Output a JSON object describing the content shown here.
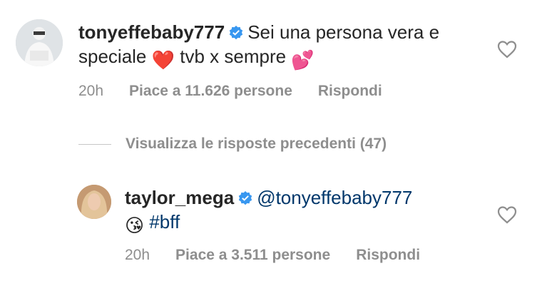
{
  "comments": [
    {
      "username": "tonyeffebaby777",
      "text_part1": "Sei una persona vera e speciale",
      "emoji1": "❤️",
      "text_part2": "tvb x sempre",
      "emoji2": "💕",
      "time": "20h",
      "likes": "Piace a 11.626 persone",
      "reply": "Rispondi"
    },
    {
      "username": "taylor_mega",
      "mention": "@tonyeffebaby777",
      "emoji1": "😘",
      "hashtag": "#bff",
      "time": "20h",
      "likes": "Piace a 3.511 persone",
      "reply": "Rispondi"
    }
  ],
  "view_replies": "Visualizza le risposte precedenti (47)",
  "icons": {
    "verified": "verified-badge-icon",
    "like": "heart-outline-icon"
  },
  "colors": {
    "verified": "#3897f0",
    "link": "#00376b",
    "meta": "#8e8e8e"
  }
}
